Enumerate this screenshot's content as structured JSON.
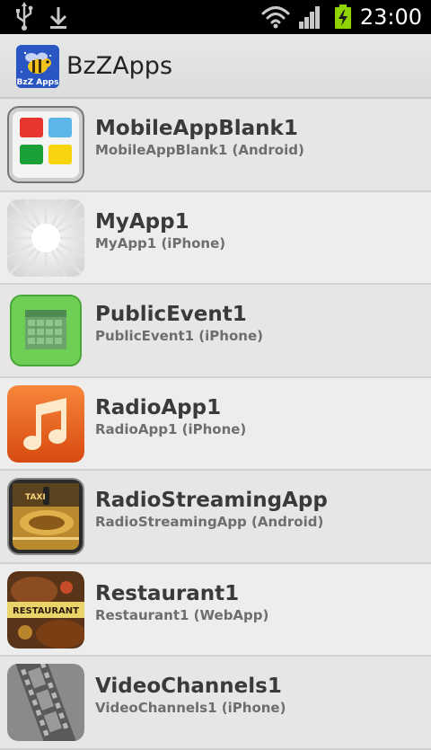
{
  "status_bar": {
    "clock": "23:00",
    "icons": [
      "usb-icon",
      "download-icon",
      "wifi-icon",
      "signal-icon",
      "battery-charging-icon"
    ]
  },
  "action_bar": {
    "title": "BzZApps",
    "logo": "bzzapps-logo"
  },
  "apps": [
    {
      "name": "MobileAppBlank1",
      "subtitle": "MobileAppBlank1 (Android)",
      "icon": "tiles-icon"
    },
    {
      "name": "MyApp1",
      "subtitle": "MyApp1 (iPhone)",
      "icon": "sunburst-icon"
    },
    {
      "name": "PublicEvent1",
      "subtitle": "PublicEvent1 (iPhone)",
      "icon": "calendar-icon"
    },
    {
      "name": "RadioApp1",
      "subtitle": "RadioApp1 (iPhone)",
      "icon": "music-note-icon"
    },
    {
      "name": "RadioStreamingApp",
      "subtitle": "RadioStreamingApp (Android)",
      "icon": "taxi-icon"
    },
    {
      "name": "Restaurant1",
      "subtitle": "Restaurant1 (WebApp)",
      "icon": "restaurant-icon"
    },
    {
      "name": "VideoChannels1",
      "subtitle": "VideoChannels1 (iPhone)",
      "icon": "film-strip-icon"
    }
  ],
  "colors": {
    "status_bar_bg": "#000000",
    "action_bar_bg": "#e0e0e0",
    "list_bg": "#ebebeb",
    "title_text": "#3a3a3a",
    "subtitle_text": "#6e6e6e",
    "battery_green": "#8fd400"
  }
}
